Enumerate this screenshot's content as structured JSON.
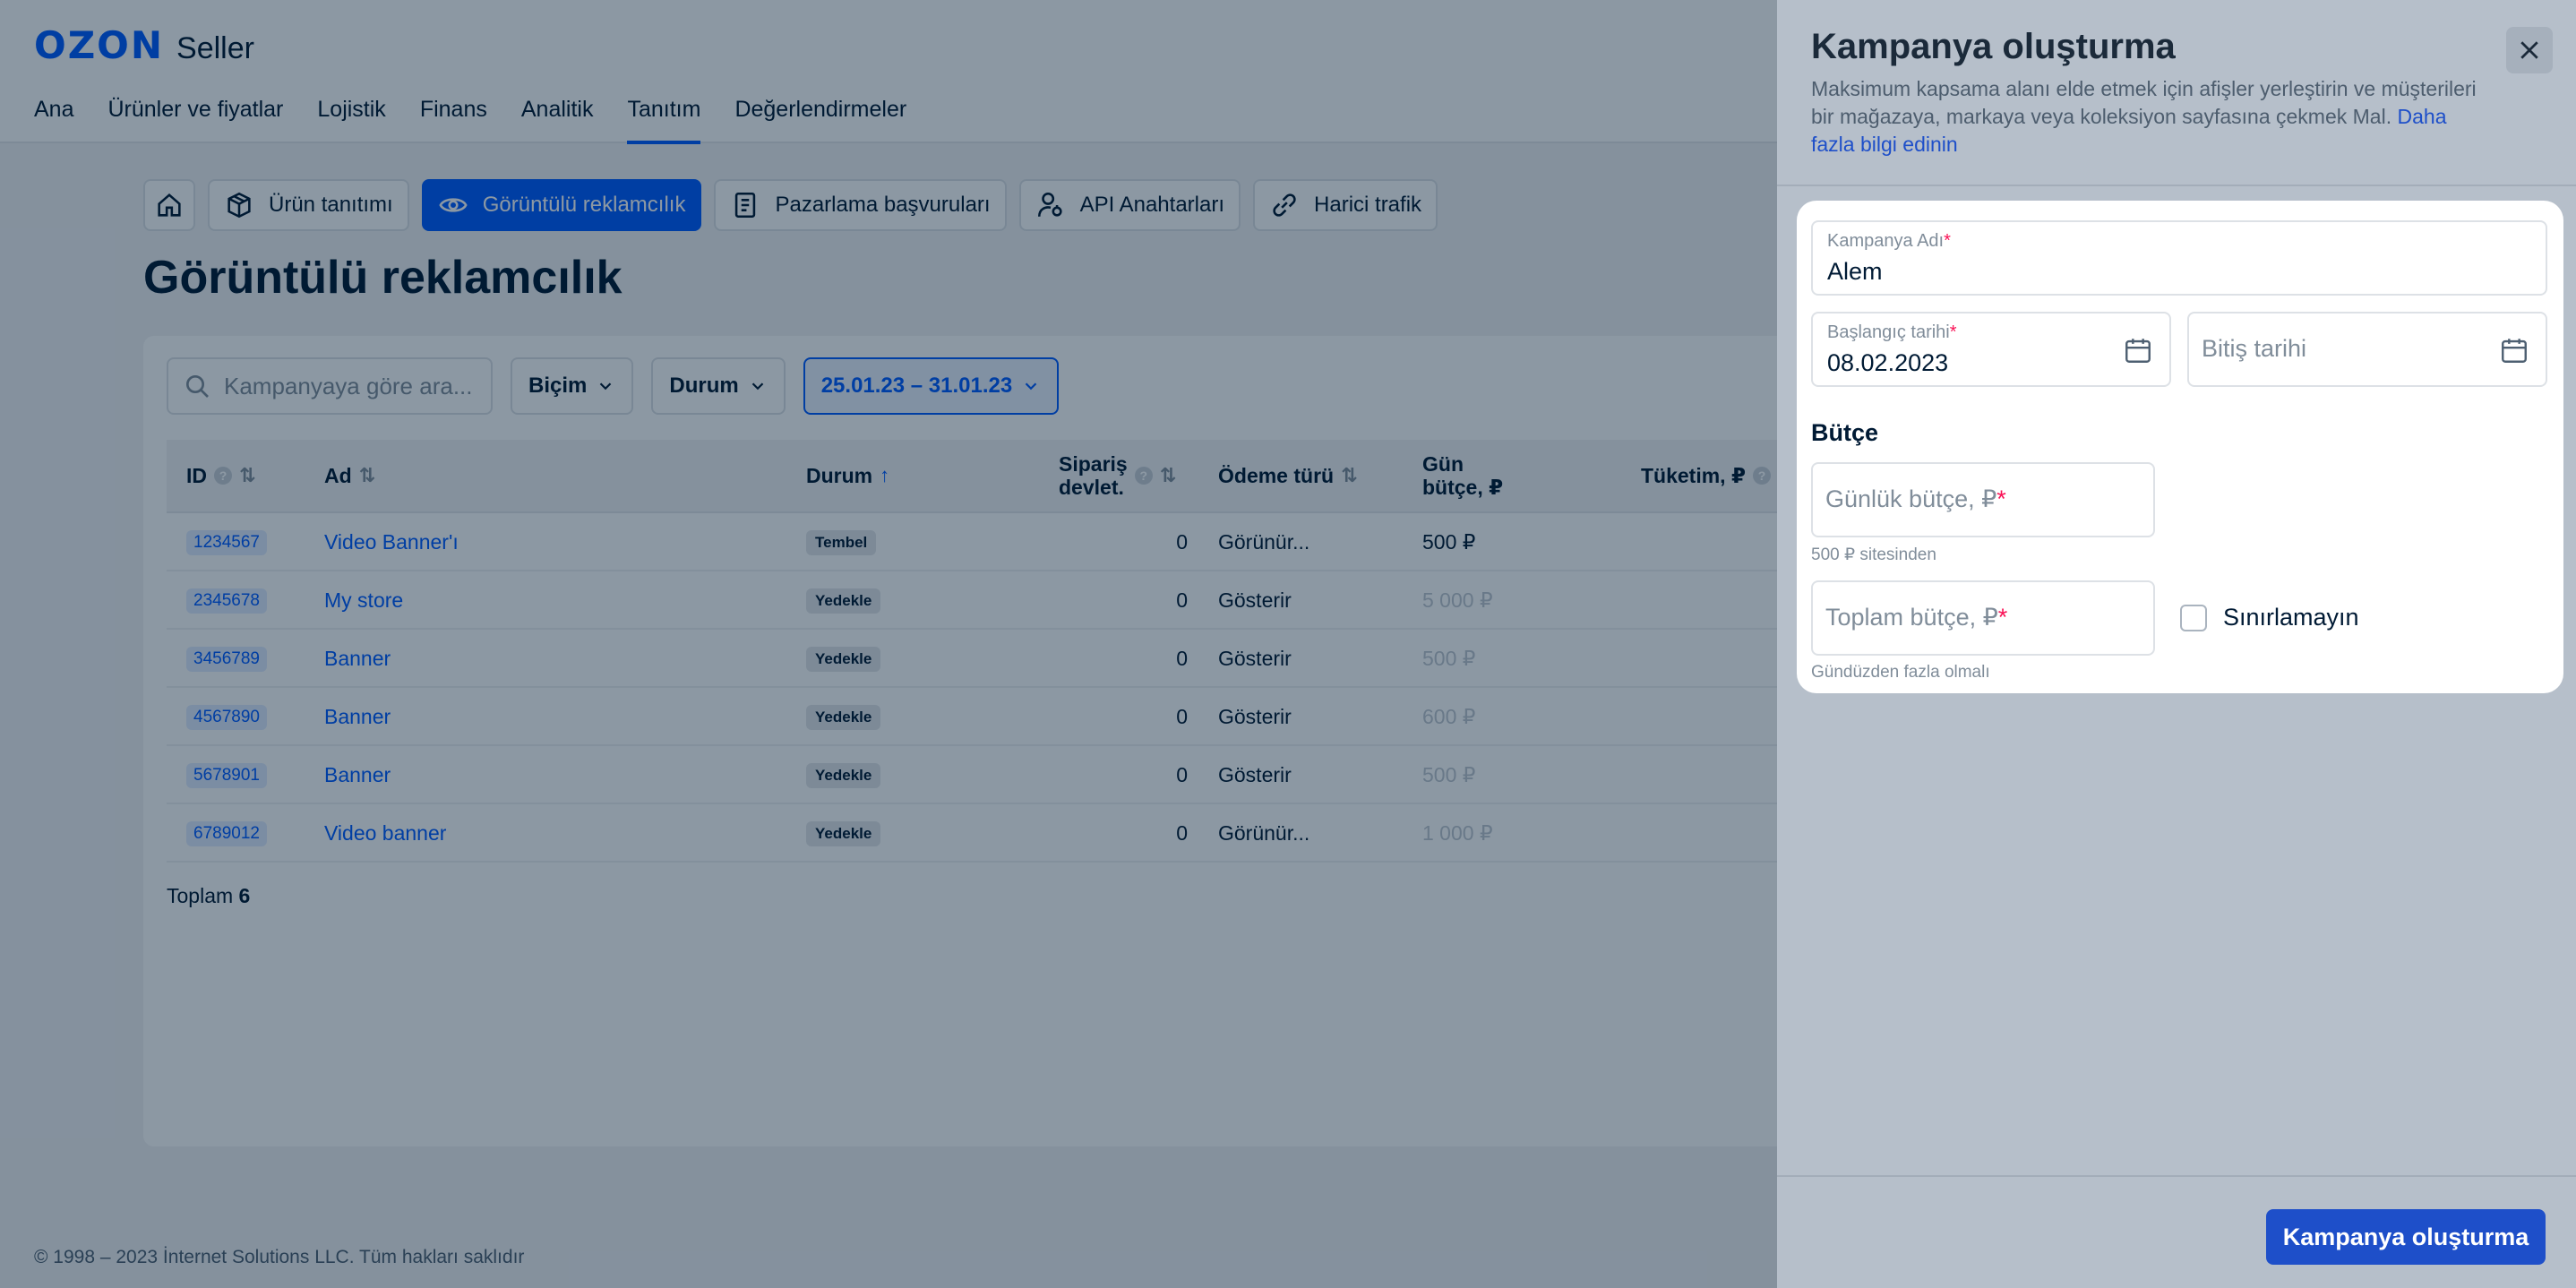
{
  "brand": {
    "logo": "OZON",
    "product": "Seller"
  },
  "nav": [
    "Ana",
    "Ürünler ve fiyatlar",
    "Lojistik",
    "Finans",
    "Analitik",
    "Tanıtım",
    "Değerlendirmeler"
  ],
  "subtabs": [
    "Ürün tanıtımı",
    "Görüntülü reklamcılık",
    "Pazarlama başvuruları",
    "API Anahtarları",
    "Harici trafik"
  ],
  "page_title": "Görüntülü reklamcılık",
  "filters": {
    "search_placeholder": "Kampanyaya göre ara...",
    "format_label": "Biçim",
    "status_label": "Durum",
    "date_range": "25.01.23 – 31.01.23"
  },
  "table": {
    "columns": {
      "id": "ID",
      "name": "Ad",
      "status": "Durum",
      "orders_1": "Sipariş",
      "orders_2": "devlet.",
      "payment": "Ödeme türü",
      "budget_1": "Gün",
      "budget_2": "bütçe, ₽",
      "spend": "Tüketim, ₽"
    },
    "rows": [
      {
        "id": "1234567",
        "name": "Video Banner'ı",
        "status": "Tembel",
        "orders": "0",
        "payment": "Görünür...",
        "budget": "500 ₽"
      },
      {
        "id": "2345678",
        "name": "My store",
        "status": "Yedekle",
        "orders": "0",
        "payment": "Gösterir",
        "budget": "5 000 ₽"
      },
      {
        "id": "3456789",
        "name": "Banner",
        "status": "Yedekle",
        "orders": "0",
        "payment": "Gösterir",
        "budget": "500 ₽"
      },
      {
        "id": "4567890",
        "name": "Banner",
        "status": "Yedekle",
        "orders": "0",
        "payment": "Gösterir",
        "budget": "600 ₽"
      },
      {
        "id": "5678901",
        "name": "Banner",
        "status": "Yedekle",
        "orders": "0",
        "payment": "Gösterir",
        "budget": "500 ₽"
      },
      {
        "id": "6789012",
        "name": "Video banner",
        "status": "Yedekle",
        "orders": "0",
        "payment": "Görünür...",
        "budget": "1 000 ₽"
      }
    ],
    "total_label": "Toplam",
    "total_count": "6"
  },
  "footer_text": "© 1998 – 2023 İnternet Solutions LLC. Tüm hakları saklıdır",
  "drawer": {
    "title": "Kampanya oluşturma",
    "description": "Maksimum kapsama alanı elde etmek için afişler yerleştirin ve müşterileri bir mağazaya, markaya veya koleksiyon sayfasına çekmek Mal.",
    "more_link": "Daha fazla bilgi edinin",
    "campaign_name_label": "Kampanya Adı",
    "campaign_name_value": "Alem",
    "start_date_label": "Başlangıç tarihi",
    "start_date_value": "08.02.2023",
    "end_date_placeholder": "Bitiş tarihi",
    "budget_section": "Bütçe",
    "daily_budget_placeholder": "Günlük bütçe, ₽",
    "daily_budget_hint": "500 ₽ sitesinden",
    "total_budget_placeholder": "Toplam bütçe, ₽",
    "total_budget_hint": "Gündüzden fazla olmalı",
    "no_limit_label": "Sınırlamayın",
    "submit_label": "Kampanya oluşturma"
  },
  "colors": {
    "accent": "#005bff",
    "required": "#f91155",
    "overlay": "rgba(0,26,52,0.45)"
  }
}
